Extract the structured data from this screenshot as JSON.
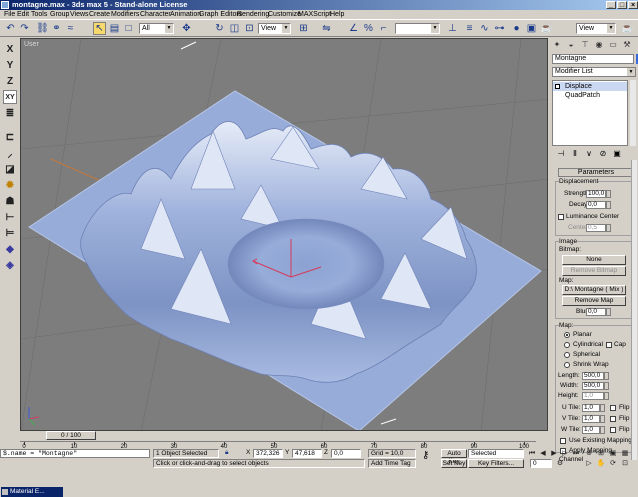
{
  "window": {
    "title": "montagne.max - 3ds max 5 - Stand-alone License",
    "minimize": "_",
    "maximize": "□",
    "close": "×"
  },
  "menu": [
    "File",
    "Edit",
    "Tools",
    "Group",
    "Views",
    "Create",
    "Modifiers",
    "Character",
    "Animation",
    "Graph Editors",
    "Rendering",
    "Customize",
    "MAXScript",
    "Help"
  ],
  "toolbar": {
    "selection_filter": "All",
    "ref_coord": "View",
    "named_selection": ""
  },
  "left_toolbar": {
    "axis_x": "X",
    "axis_y": "Y",
    "axis_z": "Z",
    "axis_xy": "XY"
  },
  "viewport": {
    "label": "User"
  },
  "command_panel": {
    "object_name": "Montagne",
    "modifier_list": "Modifier List",
    "stack": [
      {
        "label": "Displace"
      },
      {
        "label": "QuadPatch"
      }
    ],
    "rollout_title": "Parameters",
    "displacement": {
      "group_label": "Displacement",
      "strength_label": "Strength:",
      "strength_value": "100,0",
      "decay_label": "Decay:",
      "decay_value": "0,0",
      "luminance_label": "Luminance Center",
      "center_label": "Center:",
      "center_value": "0,5"
    },
    "image": {
      "group_label": "Image",
      "bitmap_label": "Bitmap:",
      "bitmap_button": "None",
      "remove_bitmap": "Remove Bitmap",
      "map_label": "Map:",
      "map_button": "D:\\ Montagne  ( Mix )",
      "remove_map": "Remove Map",
      "blur_label": "Blur:",
      "blur_value": "0,0"
    },
    "map": {
      "group_label": "Map:",
      "planar": "Planar",
      "cylindrical": "Cylindrical",
      "cap": "Cap",
      "spherical": "Spherical",
      "shrink_wrap": "Shrink Wrap",
      "length_label": "Length:",
      "length_value": "500,0",
      "width_label": "Width:",
      "width_value": "500,0",
      "height_label": "Height:",
      "height_value": "1,0",
      "utile_label": "U Tile:",
      "utile_value": "1,0",
      "vtile_label": "V Tile:",
      "vtile_value": "1,0",
      "wtile_label": "W Tile:",
      "wtile_value": "1,0",
      "flip": "Flip",
      "use_existing": "Use Existing Mapping",
      "apply_mapping": "Apply Mapping",
      "channel_group": "Channel"
    }
  },
  "timeline": {
    "slider": "0 / 100",
    "ticks": [
      "0",
      "10",
      "20",
      "30",
      "40",
      "50",
      "60",
      "70",
      "80",
      "90",
      "100"
    ],
    "frame": "0"
  },
  "status": {
    "maxscript": "$.name = \"Montagne\"",
    "selection": "1 Object Selected",
    "prompt": "Click or click-and-drag to select objects",
    "x_label": "X",
    "x_value": "372,326",
    "y_label": "Y",
    "y_value": "47,618",
    "z_label": "Z",
    "z_value": "0,0",
    "grid": "Grid = 10,0",
    "add_time_tag": "Add Time Tag",
    "auto_key": "Auto Key",
    "set_key": "Set Key",
    "key_mode": "Selected",
    "key_filters": "Key Filters..."
  },
  "taskbar": {
    "item": "Material E..."
  },
  "colors": {
    "terrain": "#8fa6d4",
    "viewport_bg": "#7d7d7d",
    "selection_highlight": "#f6d96a"
  }
}
